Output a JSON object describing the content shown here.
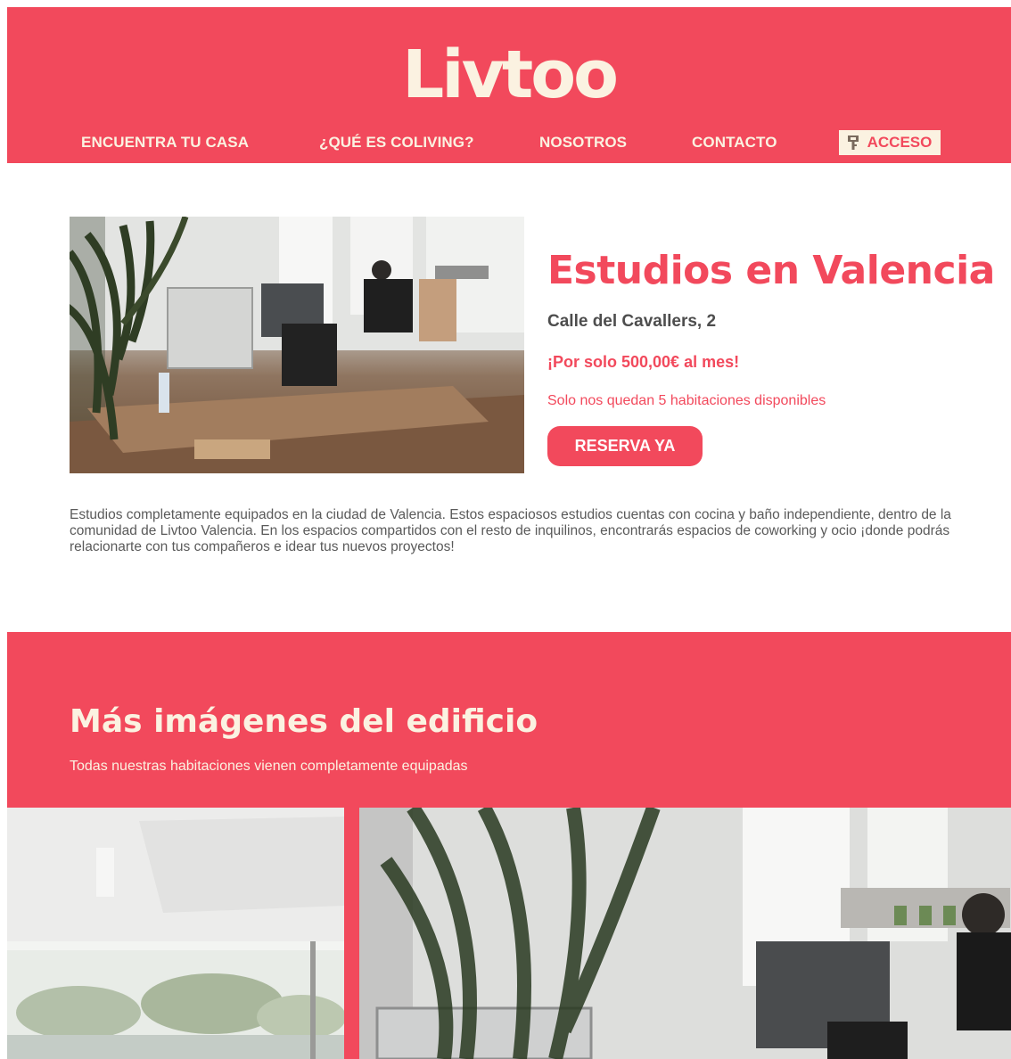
{
  "header": {
    "logo": "Livtoo",
    "nav": [
      {
        "label": "ENCUENTRA TU CASA"
      },
      {
        "label": "¿QUÉ ES COLIVING?"
      },
      {
        "label": "NOSOTROS"
      },
      {
        "label": "CONTACTO"
      }
    ],
    "access": {
      "label": "ACCESO",
      "icon": "key-icon"
    }
  },
  "hero": {
    "title": "Estudios en Valencia",
    "address": "Calle del Cavallers, 2",
    "price": "¡Por solo 500,00€ al mes!",
    "availability": "Solo nos quedan 5 habitaciones disponibles",
    "cta": "RESERVA YA",
    "image": "office-photo"
  },
  "description": "Estudios completamente equipados en la ciudad de Valencia. Estos espaciosos estudios cuentas con cocina y baño independiente, dentro de la comunidad de Livtoo Valencia. En los espacios compartidos con el resto de inquilinos, encontrarás espacios de coworking y ocio ¡donde podrás relacionarte con tus compañeros e idear tus nuevos proyectos!",
  "gallery": {
    "title": "Más imágenes del edificio",
    "subtitle": "Todas nuestras habitaciones vienen completamente equipadas",
    "images": [
      "room-window-photo",
      "office-photo"
    ]
  },
  "colors": {
    "brand": "#f2495c",
    "cream": "#fbf2e1",
    "text": "#5a5a5a"
  }
}
